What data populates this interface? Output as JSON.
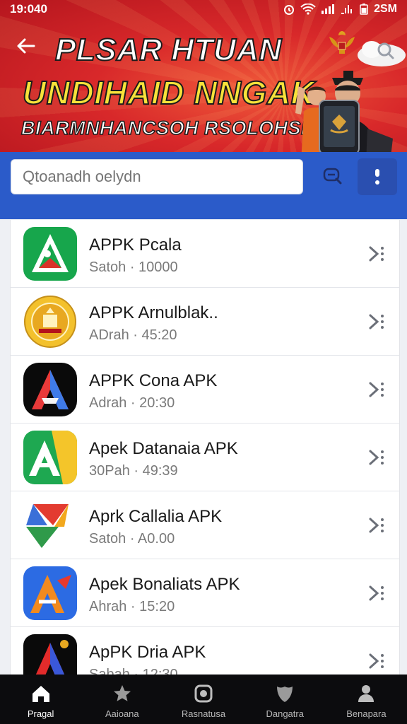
{
  "status_bar": {
    "time": "19:040",
    "right_text": "2SM"
  },
  "header": {
    "title_line1": "PLSAR HTUAN",
    "title_line2": "UNDIHAID NNGAK",
    "title_line3": "BIARMNHANCSOH RSOLOHSIS"
  },
  "search": {
    "placeholder": "Qtoanadh oelydn"
  },
  "apps": [
    {
      "name": "APPK Pcala",
      "meta": "Satoh · 10000",
      "icon": "app-icon-green-triangle"
    },
    {
      "name": "APPK Arnulblak..",
      "meta": "ADrah · 45:20",
      "icon": "app-icon-gold-seal"
    },
    {
      "name": "APPK Cona APK",
      "meta": "Adrah · 20:30",
      "icon": "app-icon-black-gradient-a"
    },
    {
      "name": "Apek Datanaia APK",
      "meta": "30Pah · 49:39",
      "icon": "app-icon-green-yellow-a"
    },
    {
      "name": "Aprk Callalia APK",
      "meta": "Satoh · A0.00",
      "icon": "app-icon-colorful-arrow"
    },
    {
      "name": "Apek Bonaliats APK",
      "meta": "Ahrah · 15:20",
      "icon": "app-icon-blue-orange-a"
    },
    {
      "name": "ApPK Dria APK",
      "meta": "Sabah · 12:30",
      "icon": "app-icon-black-red-a"
    }
  ],
  "nav": [
    {
      "label": "Pragal",
      "icon": "home-icon",
      "active": true
    },
    {
      "label": "Aaioana",
      "icon": "star-icon",
      "active": false
    },
    {
      "label": "Rasnatusa",
      "icon": "camera-icon",
      "active": false
    },
    {
      "label": "Dangatra",
      "icon": "shield-icon",
      "active": false
    },
    {
      "label": "Benapara",
      "icon": "person-icon",
      "active": false
    }
  ],
  "colors": {
    "banner_red": "#d8282a",
    "search_blue": "#2b5bc9",
    "title_yellow": "#f7e23a",
    "nav_bg": "#0c0c0e"
  }
}
